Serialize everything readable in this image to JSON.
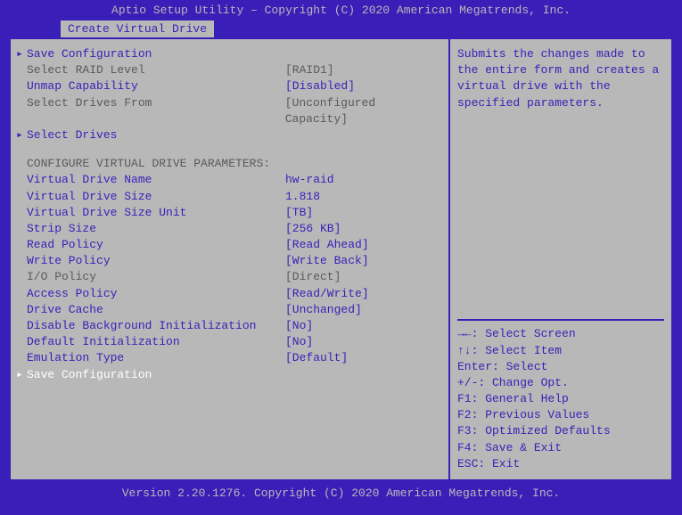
{
  "header": {
    "title": "Aptio Setup Utility – Copyright (C) 2020 American Megatrends, Inc."
  },
  "tab": {
    "label": "Create Virtual Drive"
  },
  "menu": {
    "items": [
      {
        "label": "Save Configuration",
        "value": "",
        "arrow": true,
        "style": "blue"
      },
      {
        "label": "Select RAID Level",
        "value": "[RAID1]",
        "arrow": false,
        "style": "grey"
      },
      {
        "label": "Unmap Capability",
        "value": "[Disabled]",
        "arrow": false,
        "style": "blue"
      },
      {
        "label": "Select Drives From",
        "value": "[Unconfigured Capacity]",
        "arrow": false,
        "style": "grey"
      },
      {
        "label": "Select Drives",
        "value": "",
        "arrow": true,
        "style": "blue"
      }
    ],
    "section_header": "CONFIGURE VIRTUAL DRIVE PARAMETERS:",
    "params": [
      {
        "label": "Virtual Drive Name",
        "value": "hw-raid",
        "style": "blue"
      },
      {
        "label": "Virtual Drive Size",
        "value": "1.818",
        "style": "blue"
      },
      {
        "label": "Virtual Drive Size Unit",
        "value": "[TB]",
        "style": "blue"
      },
      {
        "label": "Strip Size",
        "value": "[256 KB]",
        "style": "blue"
      },
      {
        "label": "Read Policy",
        "value": "[Read Ahead]",
        "style": "blue"
      },
      {
        "label": "Write Policy",
        "value": "[Write Back]",
        "style": "blue"
      },
      {
        "label": "I/O Policy",
        "value": "[Direct]",
        "style": "grey"
      },
      {
        "label": "Access Policy",
        "value": "[Read/Write]",
        "style": "blue"
      },
      {
        "label": "Drive Cache",
        "value": "[Unchanged]",
        "style": "blue"
      },
      {
        "label": "Disable Background Initialization",
        "value": "[No]",
        "style": "blue"
      },
      {
        "label": "Default Initialization",
        "value": "[No]",
        "style": "blue"
      },
      {
        "label": "Emulation Type",
        "value": "[Default]",
        "style": "blue"
      }
    ],
    "selected": {
      "label": "Save Configuration",
      "value": ""
    }
  },
  "right": {
    "help": "Submits the changes made to the entire form and creates a virtual drive with the specified parameters.",
    "hints": [
      "→←: Select Screen",
      "↑↓: Select Item",
      "Enter: Select",
      "+/-: Change Opt.",
      "F1: General Help",
      "F2: Previous Values",
      "F3: Optimized Defaults",
      "F4: Save & Exit",
      "ESC: Exit"
    ]
  },
  "footer": {
    "text": "Version 2.20.1276. Copyright (C) 2020 American Megatrends, Inc."
  }
}
